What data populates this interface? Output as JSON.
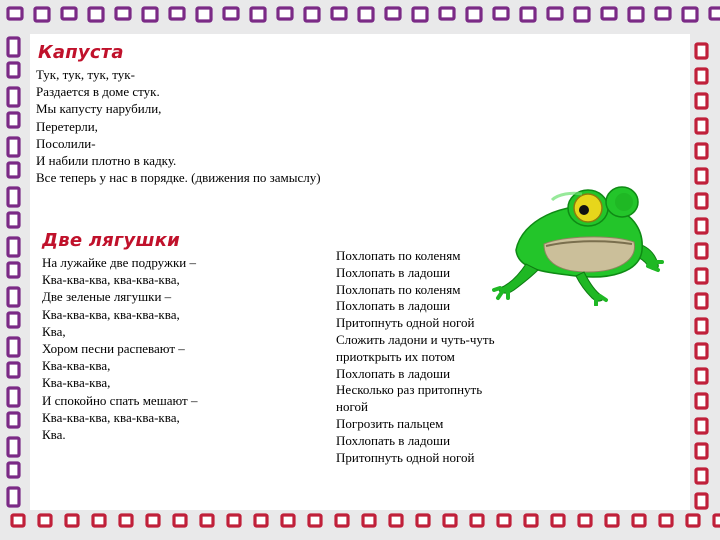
{
  "poem1": {
    "title": "Капуста",
    "lines": [
      "Тук, тук, тук, тук-",
      "Раздается в доме стук.",
      "Мы капусту нарубили,",
      "Перетерли,",
      "Посолили-",
      "И набили плотно в кадку.",
      "Все теперь у нас в порядке.  (движения по замыслу)"
    ]
  },
  "poem2": {
    "title": "Две лягушки",
    "lines": [
      "На лужайке две подружки –",
      "Ква-ква-ква, ква-ква-ква,",
      "Две зеленые лягушки –",
      "Ква-ква-ква, ква-ква-ква,",
      "Ква,",
      "Хором песни распевают –",
      "Ква-ква-ква,",
      "Ква-ква-ква,",
      "И спокойно спать мешают –",
      "Ква-ква-ква, ква-ква-ква,",
      "Ква."
    ],
    "movements": [
      "Похлопать  по коленям",
      "Похлопать  в ладоши",
      "Похлопать  по коленям",
      "Похлопать  в ладоши",
      "Притопнуть   одной ногой",
      "Сложить ладони и чуть-чуть",
      "приоткрыть  их потом",
      "Похлопать  в ладоши",
      "Несколько раз притопнуть",
      "ногой",
      "Погрозить  пальцем",
      "Похлопать  в ладоши",
      "Притопнуть   одной ногой"
    ]
  },
  "icons": {
    "frog": "frog-illustration",
    "frame": "square-pattern-border"
  },
  "colors": {
    "title": "#c0112b",
    "frame": [
      "#7b2a86",
      "#2f62b8",
      "#e07a1e",
      "#c0203a",
      "#d6b51f",
      "#3f9a3a"
    ]
  }
}
